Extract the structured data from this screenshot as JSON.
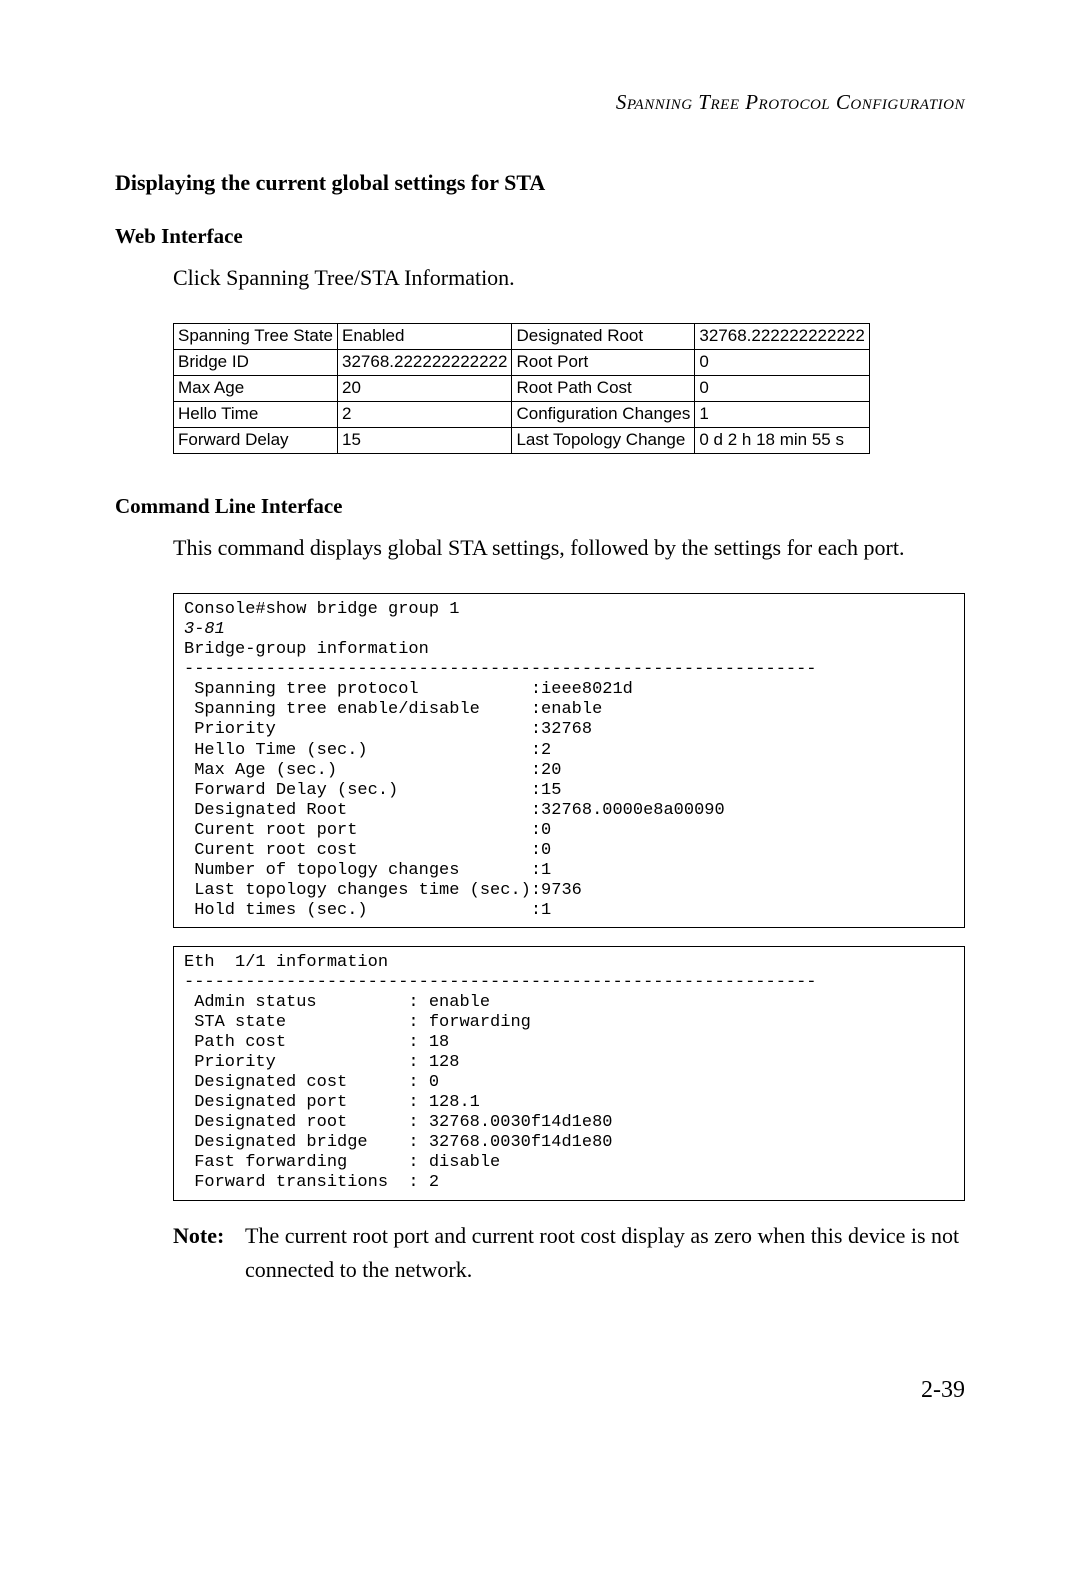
{
  "running_header": "Spanning Tree Protocol Configuration",
  "section_title": "Displaying the current global settings for STA",
  "web_interface": {
    "heading": "Web Interface",
    "text": "Click Spanning Tree/STA Information."
  },
  "sta_table": {
    "rows": [
      {
        "l1": "Spanning Tree State",
        "v1": "Enabled",
        "l2": "Designated Root",
        "v2": "32768.222222222222"
      },
      {
        "l1": "Bridge ID",
        "v1": "32768.222222222222",
        "l2": "Root Port",
        "v2": "0"
      },
      {
        "l1": "Max Age",
        "v1": "20",
        "l2": "Root Path Cost",
        "v2": "0"
      },
      {
        "l1": "Hello Time",
        "v1": "2",
        "l2": "Configuration Changes",
        "v2": "1"
      },
      {
        "l1": "Forward Delay",
        "v1": "15",
        "l2": "Last Topology Change",
        "v2": "0 d 2 h 18 min 55 s"
      }
    ]
  },
  "cli": {
    "heading": "Command Line Interface",
    "intro": "This command displays global STA settings, followed by the settings for each port.",
    "block1_cmd": "Console#show bridge group 1",
    "block1_ref": "3-81",
    "block1_body": "Bridge-group information\n--------------------------------------------------------------\n Spanning tree protocol           :ieee8021d\n Spanning tree enable/disable     :enable\n Priority                         :32768\n Hello Time (sec.)                :2\n Max Age (sec.)                   :20\n Forward Delay (sec.)             :15\n Designated Root                  :32768.0000e8a00090\n Curent root port                 :0\n Curent root cost                 :0\n Number of topology changes       :1\n Last topology changes time (sec.):9736\n Hold times (sec.)                :1",
    "block2": "Eth  1/1 information\n--------------------------------------------------------------\n Admin status         : enable\n STA state            : forwarding\n Path cost            : 18\n Priority             : 128\n Designated cost      : 0\n Designated port      : 128.1\n Designated root      : 32768.0030f14d1e80\n Designated bridge    : 32768.0030f14d1e80\n Fast forwarding      : disable\n Forward transitions  : 2"
  },
  "note": {
    "label": "Note:",
    "text": "The current root port and current root cost display as zero when this device is not connected to the network."
  },
  "page_number": "2-39"
}
